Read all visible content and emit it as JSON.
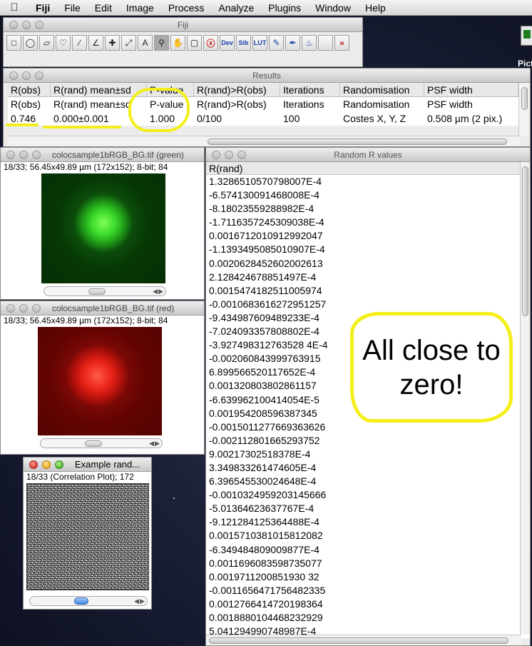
{
  "menubar": {
    "apple": "",
    "items": [
      "Fiji",
      "File",
      "Edit",
      "Image",
      "Process",
      "Analyze",
      "Plugins",
      "Window",
      "Help"
    ]
  },
  "desktop": {
    "icon_label": "Pictu"
  },
  "fiji_window": {
    "title": "Fiji",
    "tools": [
      "rectangle",
      "oval",
      "polygon",
      "freehand",
      "line",
      "angle",
      "point",
      "wand",
      "text",
      "magnifier",
      "hand",
      "color-picker",
      "delete",
      "Dev",
      "Stk",
      "LUT",
      "pencil",
      "brush",
      "flood-fill",
      "more"
    ]
  },
  "results": {
    "title": "Results",
    "headers": [
      "R(obs)",
      "R(rand) mean±sd",
      "P-value",
      "R(rand)>R(obs)",
      "Iterations",
      "Randomisation",
      "PSF width"
    ],
    "rows": [
      [
        "R(obs)",
        "R(rand) mean±sd",
        "P-value",
        "R(rand)>R(obs)",
        "Iterations",
        "Randomisation",
        "PSF width"
      ],
      [
        "0.746",
        "0.000±0.001",
        "1.000",
        "0/100",
        "100",
        "Costes X, Y, Z",
        "0.508 µm (2 pix.)"
      ]
    ]
  },
  "green_window": {
    "title": "colocsample1bRGB_BG.tif (green)",
    "info": "18/33; 56.45x49.89 µm (172x152); 8-bit; 84"
  },
  "red_window": {
    "title": "colocsample1bRGB_BG.tif (red)",
    "info": "18/33; 56.45x49.89 µm (172x152); 8-bit; 84"
  },
  "example_window": {
    "title": "Example rand...",
    "info": "18/33 (Correlation Plot); 172"
  },
  "random_r": {
    "title": "Random R values",
    "header": "R(rand)",
    "values": [
      "1.3286510570798007E-4",
      "-6.574130091468008E-4",
      "-8.18023559288982E-4",
      "-1.7116357245309038E-4",
      "0.0016712010912992047",
      "-1.1393495085010907E-4",
      "0.0020628452602002613",
      "2.128424678851497E-4",
      "0.0015474182511005974",
      "-0.0010683616272951257",
      "-9.434987609489233E-4",
      "-7.024093357808802E-4",
      "-3.927498312763528 4E-4",
      "-0.002060843999763915",
      "6.899566520117652E-4",
      "0.001320803802861157",
      "-6.639962100414054E-5",
      "0.001954208596387345",
      "-0.0015011277669363626",
      "-0.002112801665293752",
      "9.00217302518378E-4",
      "3.349833261474605E-4",
      "6.396545530024648E-4",
      "-0.0010324959203145666",
      "-5.01364623637767E-4",
      "-9.121284125364488E-4",
      "0.0015710381015812082",
      "-6.349484809009877E-4",
      "0.0011696083598735077",
      "0.0019711200851930 32",
      "-0.0011656471756482335",
      "0.0012766414720198364",
      "0.0018880104468232929",
      "5.041294990748987E-4"
    ]
  },
  "annotation": {
    "callout_text": "All close to zero!",
    "highlight_color": "#f4ef1a"
  }
}
